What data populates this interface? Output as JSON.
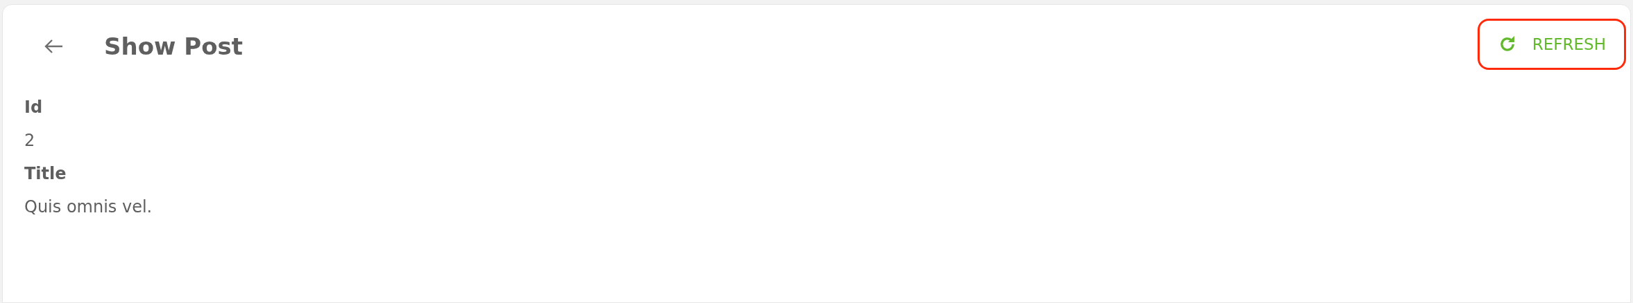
{
  "header": {
    "title": "Show Post",
    "refresh_button": "REFRESH"
  },
  "fields": [
    {
      "label": "Id",
      "value": "2"
    },
    {
      "label": "Title",
      "value": "Quis omnis vel."
    }
  ]
}
